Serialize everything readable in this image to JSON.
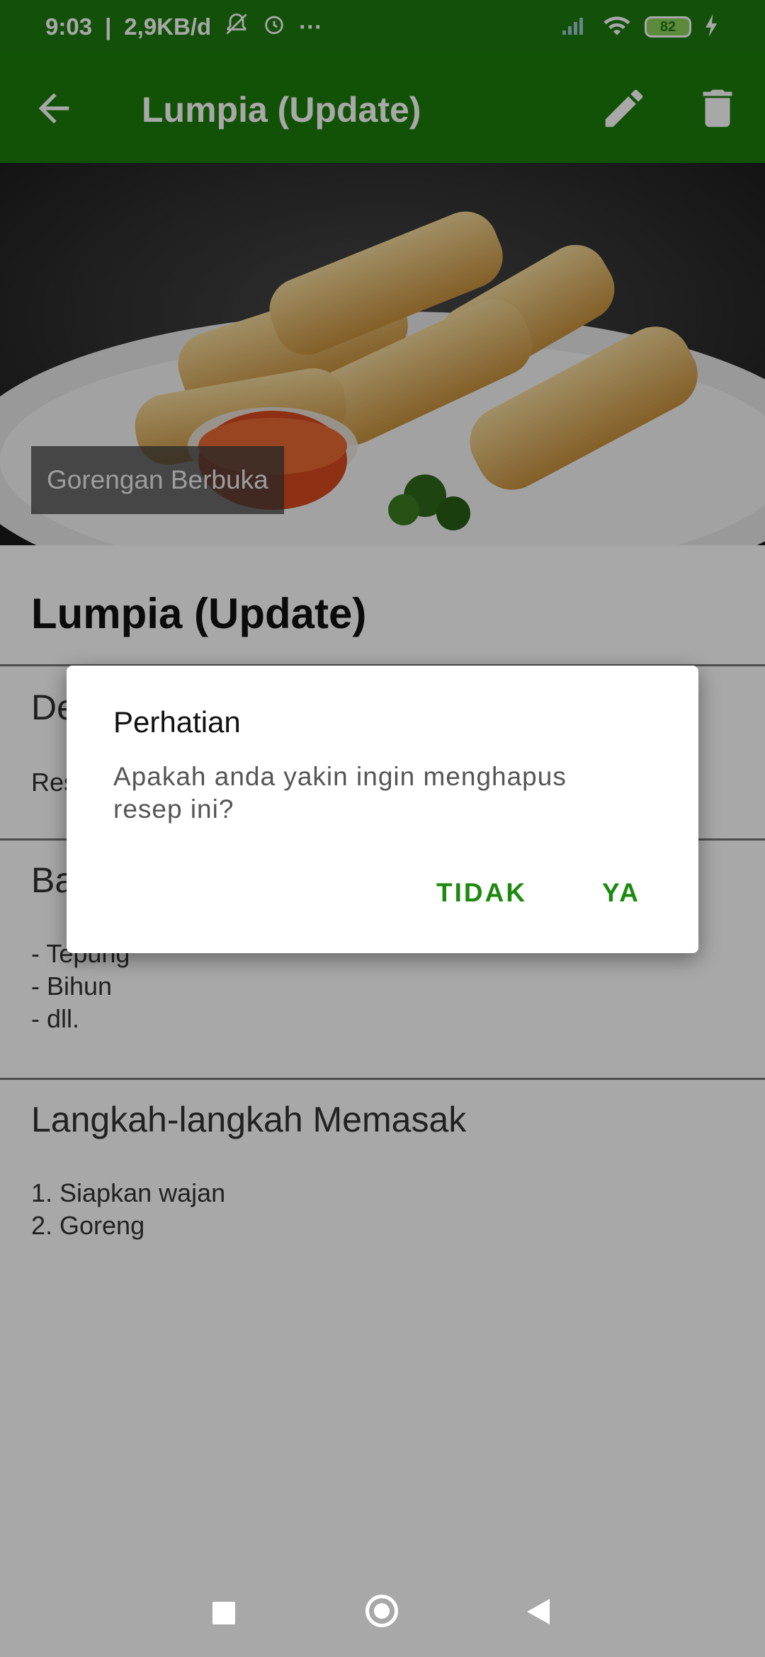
{
  "status": {
    "time": "9:03",
    "speed": "2,9KB/d",
    "more": "···",
    "battery": "82"
  },
  "appbar": {
    "title": "Lumpia (Update)",
    "back_icon": "arrow-back-icon",
    "edit_icon": "pencil-icon",
    "delete_icon": "trash-icon"
  },
  "hero": {
    "category": "Gorengan Berbuka"
  },
  "recipe": {
    "name": "Lumpia (Update)",
    "desc_title": "De",
    "desc_body": "Res",
    "ingredients_title": "Ba",
    "ingredients": [
      "- Tepung",
      "- Bihun",
      "- dll."
    ],
    "steps_title": "Langkah-langkah Memasak",
    "steps": [
      "1. Siapkan wajan",
      "2. Goreng"
    ]
  },
  "dialog": {
    "title": "Perhatian",
    "message": "Apakah anda yakin ingin menghapus resep ini?",
    "no_label": "TIDAK",
    "yes_label": "YA"
  },
  "colors": {
    "primary": "#1c7d0a",
    "accent": "#1c8a0e"
  }
}
